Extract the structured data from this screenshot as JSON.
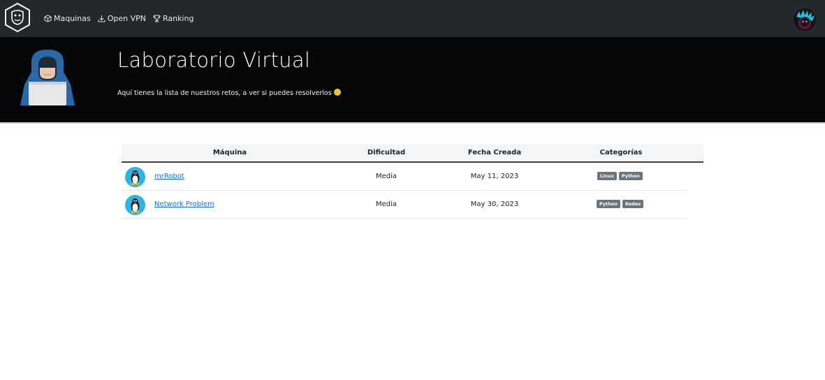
{
  "nav": {
    "links": [
      {
        "label": "Maquinas",
        "icon": "cube-icon"
      },
      {
        "label": "Open VPN",
        "icon": "download-icon"
      },
      {
        "label": "Ranking",
        "icon": "trophy-icon"
      }
    ]
  },
  "hero": {
    "title": "Laboratorio Virtual",
    "subtitle": "Aquí tienes la lista de nuestros retos, a ver si puedes resolverlos"
  },
  "table": {
    "headers": [
      "Máquina",
      "Dificultad",
      "Fecha Creada",
      "Categorías"
    ],
    "rows": [
      {
        "name": "mrRobot",
        "difficulty": "Media",
        "date": "May 11, 2023",
        "categories": [
          "Linux",
          "Python"
        ],
        "os_icon": "linux-tux-icon"
      },
      {
        "name": "Network Problem",
        "difficulty": "Media",
        "date": "May 30, 2023",
        "categories": [
          "Python",
          "Redes"
        ],
        "os_icon": "linux-tux-icon"
      }
    ]
  },
  "colors": {
    "nav_bg": "#24272c",
    "hero_bg": "#060708",
    "link": "#1a73e8",
    "badge": "#6c757d",
    "os_icon_bg": "#29b6e8"
  }
}
